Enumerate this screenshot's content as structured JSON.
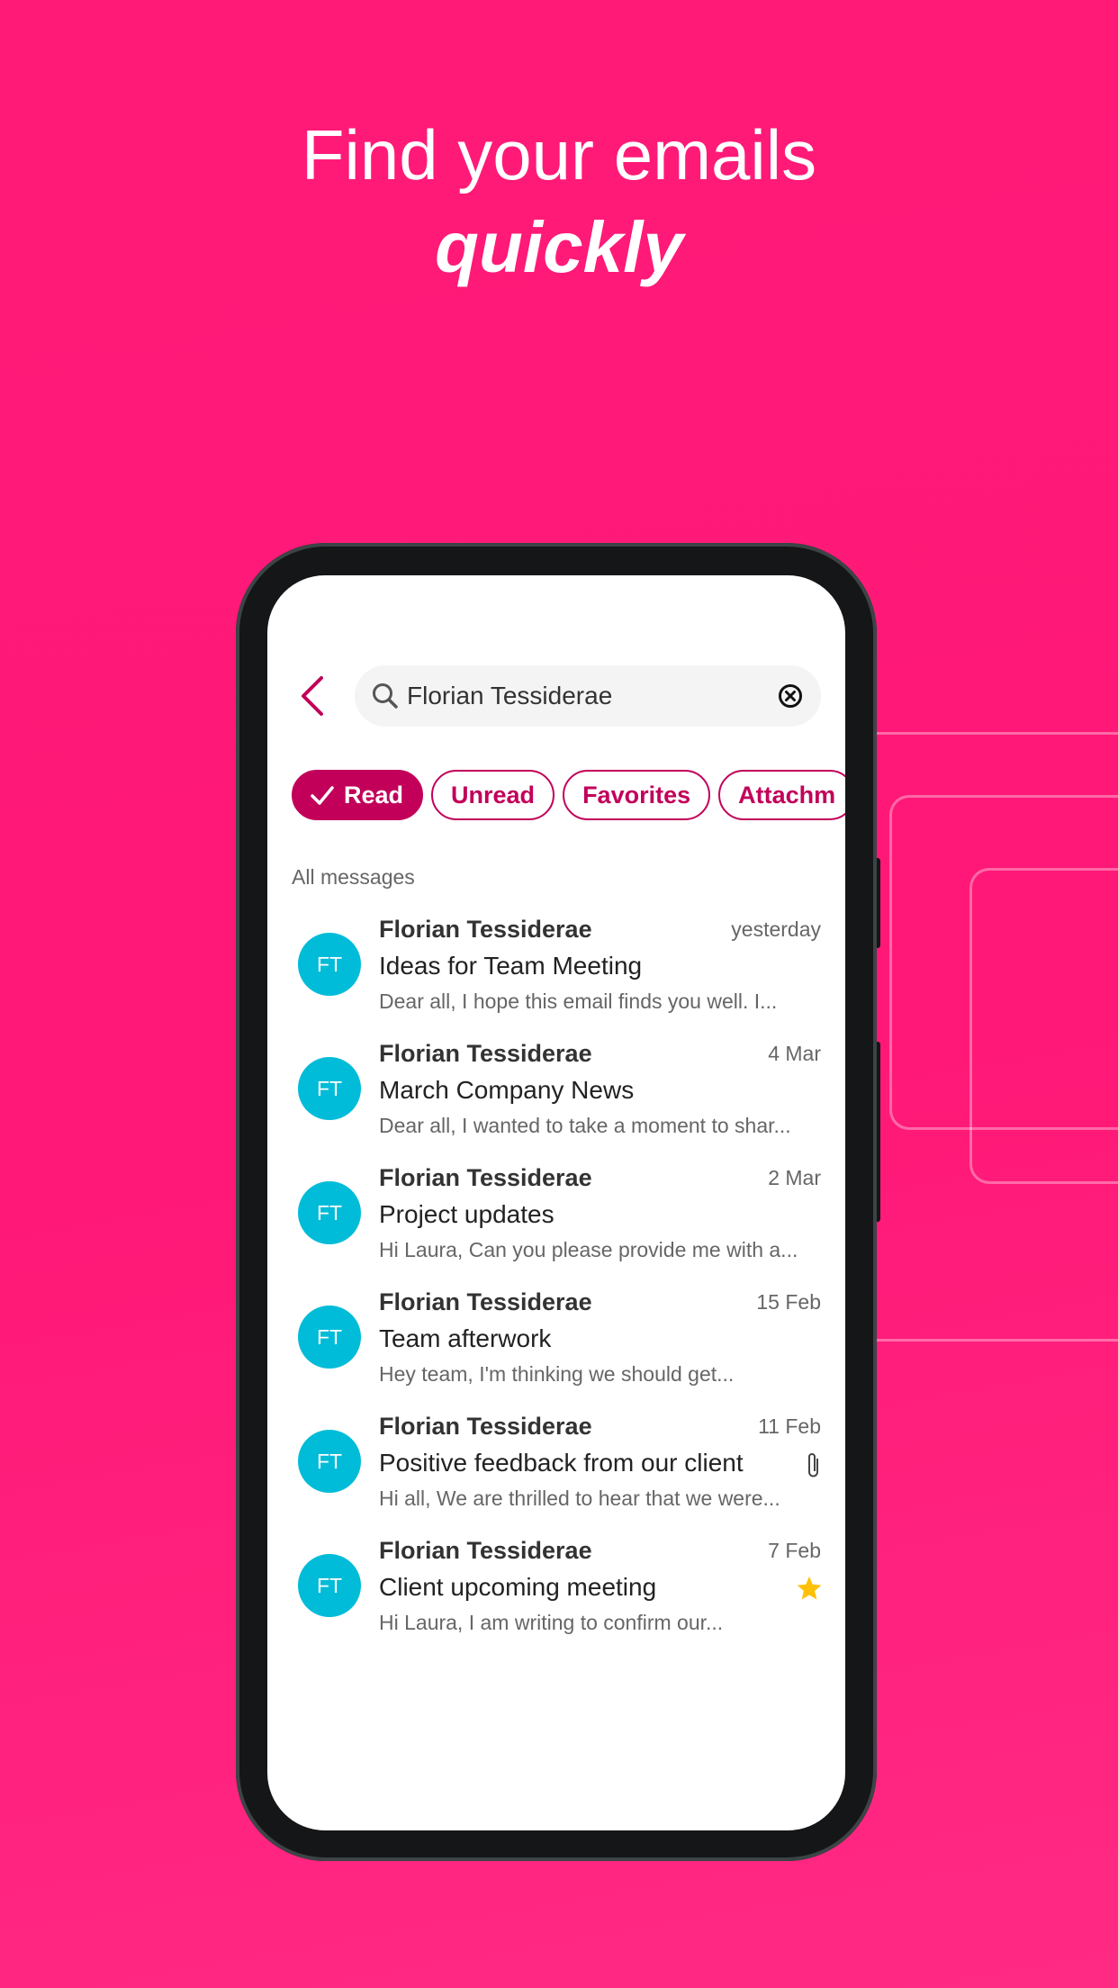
{
  "headline": {
    "line1": "Find your emails",
    "line2": "quickly"
  },
  "colors": {
    "background": "#ff1a78",
    "accent": "#c2005a",
    "avatar": "#00bcd8",
    "star": "#ffc107"
  },
  "search": {
    "value": "Florian Tessiderae",
    "icon": "search-icon",
    "clear_icon": "clear-circle-icon"
  },
  "back_icon": "chevron-left-icon",
  "chips": [
    {
      "label": "Read",
      "selected": true
    },
    {
      "label": "Unread",
      "selected": false
    },
    {
      "label": "Favorites",
      "selected": false
    },
    {
      "label": "Attachm",
      "selected": false
    }
  ],
  "section_label": "All messages",
  "messages": [
    {
      "initials": "FT",
      "sender": "Florian Tessiderae",
      "date": "yesterday",
      "subject": "Ideas for Team Meeting",
      "preview": "Dear all, I hope this email finds you well. I...",
      "icon": ""
    },
    {
      "initials": "FT",
      "sender": "Florian Tessiderae",
      "date": "4 Mar",
      "subject": "March Company News",
      "preview": "Dear all, I wanted to take a moment to shar...",
      "icon": ""
    },
    {
      "initials": "FT",
      "sender": "Florian Tessiderae",
      "date": "2 Mar",
      "subject": "Project updates",
      "preview": "Hi Laura, Can you please provide me with a...",
      "icon": ""
    },
    {
      "initials": "FT",
      "sender": "Florian Tessiderae",
      "date": "15 Feb",
      "subject": "Team afterwork",
      "preview": "Hey team, I'm thinking we should get...",
      "icon": ""
    },
    {
      "initials": "FT",
      "sender": "Florian Tessiderae",
      "date": "11 Feb",
      "subject": "Positive feedback from our client",
      "preview": "Hi all, We are thrilled to hear that we were...",
      "icon": "paperclip-icon"
    },
    {
      "initials": "FT",
      "sender": "Florian Tessiderae",
      "date": "7 Feb",
      "subject": "Client upcoming meeting",
      "preview": "Hi Laura, I am writing to confirm our...",
      "icon": "star-icon"
    }
  ]
}
